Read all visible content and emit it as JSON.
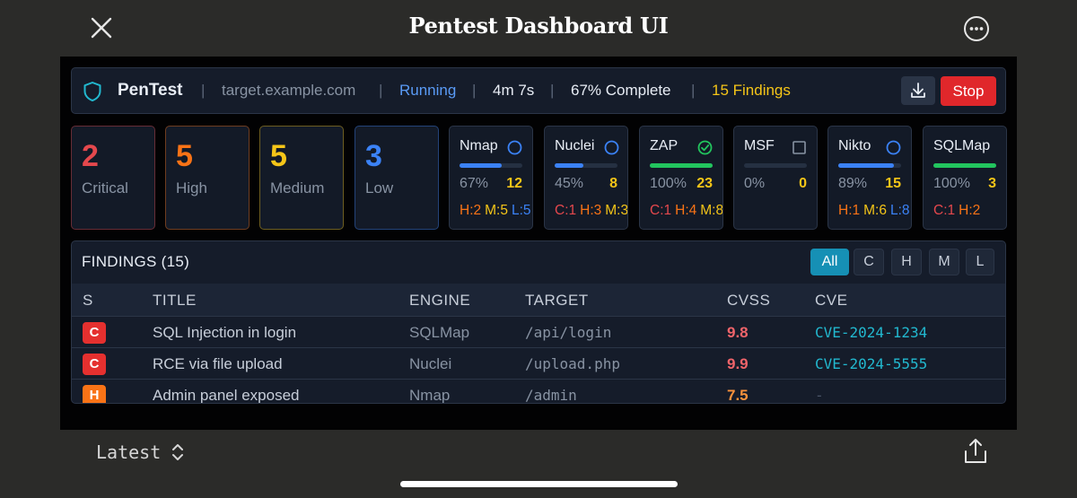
{
  "app_title": "Pentest Dashboard UI",
  "header": {
    "brand": "PenTest",
    "target": "target.example.com",
    "status": "Running",
    "elapsed": "4m 7s",
    "progress_text": "67% Complete",
    "findings_text": "15 Findings",
    "stop_label": "Stop",
    "separator": "|"
  },
  "severity": [
    {
      "count": "2",
      "label": "Critical",
      "color": "#e5484d"
    },
    {
      "count": "5",
      "label": "High",
      "color": "#f97316"
    },
    {
      "count": "5",
      "label": "Medium",
      "color": "#f5c518"
    },
    {
      "count": "3",
      "label": "Low",
      "color": "#3b82f6"
    }
  ],
  "engines": [
    {
      "name": "Nmap",
      "icon": "circle-icon",
      "progress": 0.67,
      "bar_color": "#3b82f6",
      "pct": "67%",
      "count": "12",
      "breakdown": [
        {
          "t": "H:2",
          "c": "#f97316"
        },
        {
          "t": "M:5",
          "c": "#f5c518"
        },
        {
          "t": "L:5",
          "c": "#3b82f6"
        }
      ]
    },
    {
      "name": "Nuclei",
      "icon": "circle-icon",
      "progress": 0.45,
      "bar_color": "#3b82f6",
      "pct": "45%",
      "count": "8",
      "breakdown": [
        {
          "t": "C:1",
          "c": "#e5484d"
        },
        {
          "t": "H:3",
          "c": "#f97316"
        },
        {
          "t": "M:3",
          "c": "#f5c518"
        }
      ]
    },
    {
      "name": "ZAP",
      "icon": "check-circle-icon",
      "progress": 1.0,
      "bar_color": "#22c55e",
      "pct": "100%",
      "count": "23",
      "breakdown": [
        {
          "t": "C:1",
          "c": "#e5484d"
        },
        {
          "t": "H:4",
          "c": "#f97316"
        },
        {
          "t": "M:8",
          "c": "#f5c518"
        }
      ]
    },
    {
      "name": "MSF",
      "icon": "square-icon",
      "progress": 0.0,
      "bar_color": "#3b82f6",
      "pct": "0%",
      "count": "0",
      "breakdown": []
    },
    {
      "name": "Nikto",
      "icon": "circle-icon",
      "progress": 0.89,
      "bar_color": "#3b82f6",
      "pct": "89%",
      "count": "15",
      "breakdown": [
        {
          "t": "H:1",
          "c": "#f97316"
        },
        {
          "t": "M:6",
          "c": "#f5c518"
        },
        {
          "t": "L:8",
          "c": "#3b82f6"
        }
      ]
    },
    {
      "name": "SQLMap",
      "icon": "",
      "progress": 1.0,
      "bar_color": "#22c55e",
      "pct": "100%",
      "count": "3",
      "breakdown": [
        {
          "t": "C:1",
          "c": "#e5484d"
        },
        {
          "t": "H:2",
          "c": "#f97316"
        }
      ]
    }
  ],
  "findings": {
    "title": "FINDINGS (15)",
    "filters": [
      "All",
      "C",
      "H",
      "M",
      "L"
    ],
    "active_filter": "All",
    "columns": {
      "s": "S",
      "title": "TITLE",
      "engine": "ENGINE",
      "target": "TARGET",
      "cvss": "CVSS",
      "cve": "CVE"
    },
    "rows": [
      {
        "sev": "C",
        "sev_color": "#e5302f",
        "title": "SQL Injection in login",
        "engine": "SQLMap",
        "target": "/api/login",
        "cvss": "9.8",
        "cvss_color": "#f0646a",
        "cve": "CVE-2024-1234"
      },
      {
        "sev": "C",
        "sev_color": "#e5302f",
        "title": "RCE via file upload",
        "engine": "Nuclei",
        "target": "/upload.php",
        "cvss": "9.9",
        "cvss_color": "#f0646a",
        "cve": "CVE-2024-5555"
      },
      {
        "sev": "H",
        "sev_color": "#f97316",
        "title": "Admin panel exposed",
        "engine": "Nmap",
        "target": "/admin",
        "cvss": "7.5",
        "cvss_color": "#fb923c",
        "cve": "-"
      }
    ]
  },
  "bottom": {
    "version_label": "Latest"
  }
}
